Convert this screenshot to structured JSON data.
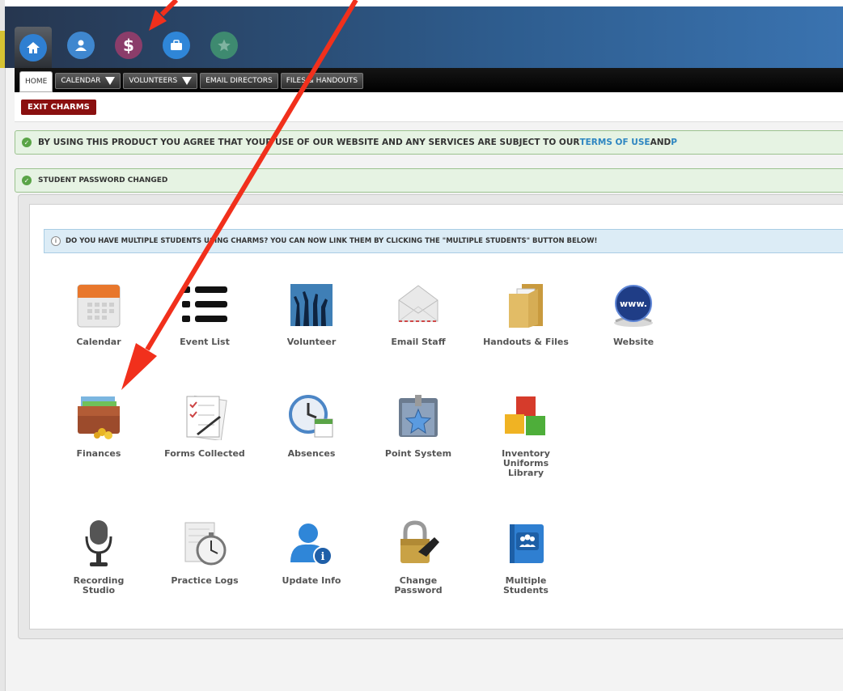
{
  "nav": {
    "icons": [
      {
        "name": "home-icon",
        "color": "#2f7fd1"
      },
      {
        "name": "user-icon",
        "color": "#3f87cf"
      },
      {
        "name": "dollar-icon",
        "color": "#8b3d6a",
        "glyph": "$"
      },
      {
        "name": "briefcase-icon",
        "color": "#2f86d8"
      },
      {
        "name": "star-icon",
        "color": "#3e8a70"
      }
    ]
  },
  "tabs": {
    "home": "HOME",
    "calendar": "CALENDAR",
    "volunteers": "VOLUNTEERS",
    "email_directors": "EMAIL DIRECTORS",
    "files_handouts": "FILES & HANDOUTS"
  },
  "exit_button": "EXIT CHARMS",
  "terms_notice": {
    "before": "BY USING THIS PRODUCT YOU AGREE THAT YOUR USE OF OUR WEBSITE AND ANY SERVICES ARE SUBJECT TO OUR ",
    "link1": "TERMS OF USE",
    "middle": " AND ",
    "link2": "P"
  },
  "password_notice": "STUDENT PASSWORD CHANGED",
  "info_notice": "DO YOU HAVE MULTIPLE STUDENTS USING CHARMS? YOU CAN NOW LINK THEM BY CLICKING THE \"MULTIPLE STUDENTS\" BUTTON BELOW!",
  "tiles": {
    "calendar": "Calendar",
    "event_list": "Event List",
    "volunteer": "Volunteer",
    "email_staff": "Email Staff",
    "handouts_files": "Handouts & Files",
    "website": "Website",
    "finances": "Finances",
    "forms_collected": "Forms Collected",
    "absences": "Absences",
    "point_system": "Point System",
    "inventory": "Inventory\nUniforms\nLibrary",
    "recording_studio": "Recording\nStudio",
    "practice_logs": "Practice Logs",
    "update_info": "Update Info",
    "change_password": "Change\nPassword",
    "multiple_students": "Multiple\nStudents"
  },
  "colors": {
    "header_dark": "#26364f",
    "exit_red": "#8a1010",
    "link_blue": "#2e86c1",
    "success_green": "#5aa447",
    "annotation_red": "#f1301c"
  }
}
